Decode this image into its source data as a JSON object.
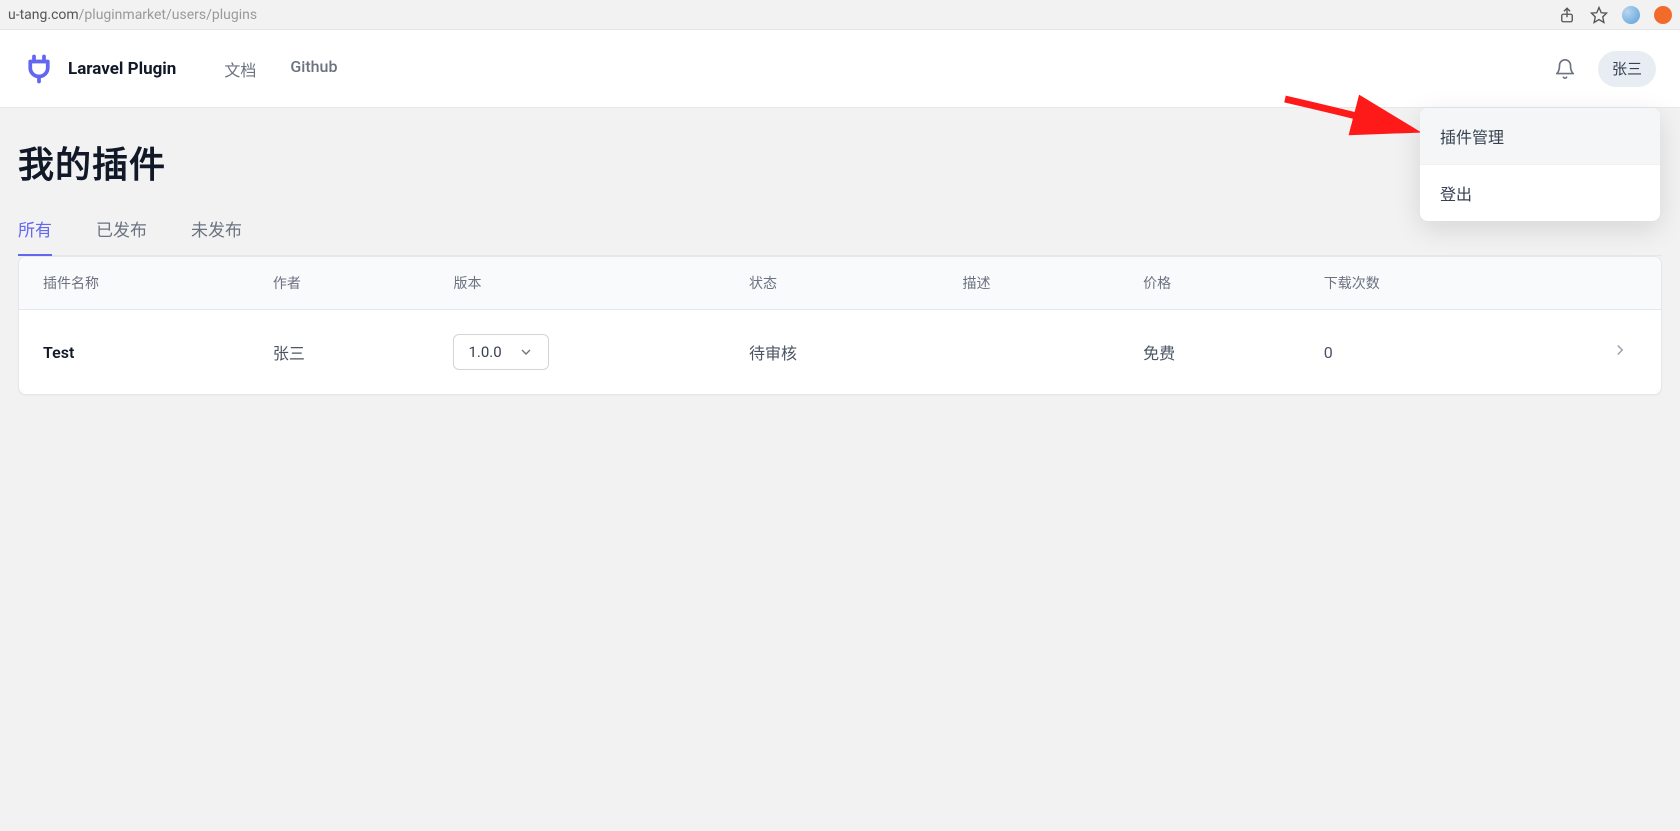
{
  "browser": {
    "url_prefix": "u-tang.com",
    "url_path": "/pluginmarket/users/plugins"
  },
  "header": {
    "brand": "Laravel Plugin",
    "nav": [
      {
        "label": "文档"
      },
      {
        "label": "Github"
      }
    ],
    "username": "张三",
    "dropdown": [
      {
        "label": "插件管理",
        "highlight": true
      },
      {
        "label": "登出",
        "highlight": false
      }
    ]
  },
  "page": {
    "title": "我的插件",
    "tabs": [
      {
        "label": "所有",
        "active": true
      },
      {
        "label": "已发布",
        "active": false
      },
      {
        "label": "未发布",
        "active": false
      }
    ]
  },
  "table": {
    "headers": {
      "name": "插件名称",
      "author": "作者",
      "version": "版本",
      "status": "状态",
      "description": "描述",
      "price": "价格",
      "downloads": "下载次数"
    },
    "rows": [
      {
        "name": "Test",
        "author": "张三",
        "version": "1.0.0",
        "status": "待审核",
        "description": "",
        "price": "免费",
        "downloads": "0"
      }
    ]
  }
}
